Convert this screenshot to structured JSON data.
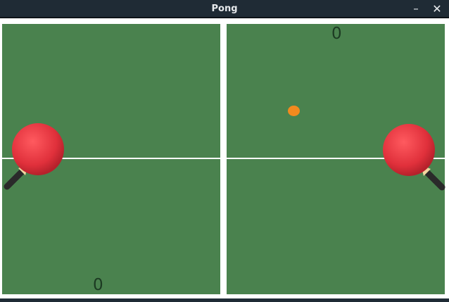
{
  "window": {
    "title": "Pong",
    "minimize_symbol": "–",
    "close_symbol": "✕"
  },
  "scores": {
    "top": "0",
    "bottom": "0"
  },
  "colors": {
    "table": "#4a824e",
    "ball": "#f28a1e",
    "paddle": "#e3343f",
    "titlebar": "#1f2b35"
  },
  "icons": {
    "left_paddle": "ping-pong-paddle-icon",
    "right_paddle": "ping-pong-paddle-icon"
  }
}
